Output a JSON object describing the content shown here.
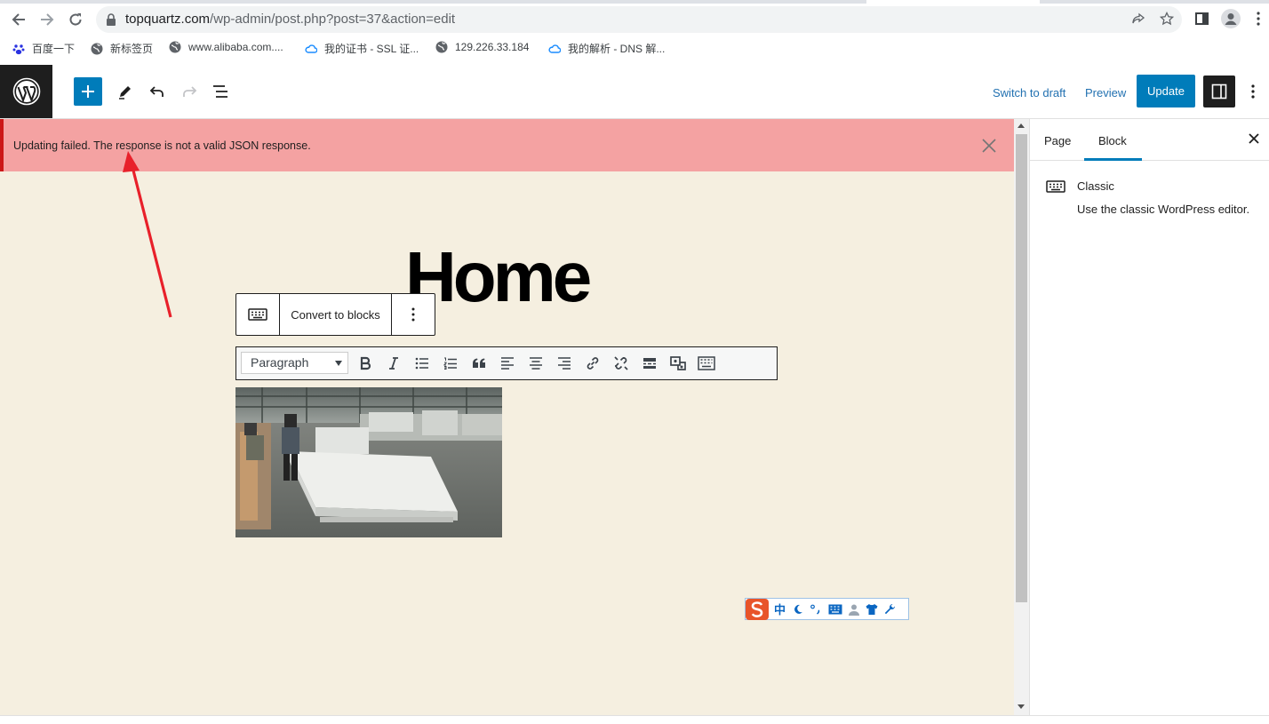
{
  "browser": {
    "url_host": "topquartz.com",
    "url_path": "/wp-admin/post.php?post=37&action=edit",
    "bookmarks": [
      {
        "label": "百度一下"
      },
      {
        "label": "新标签页"
      },
      {
        "label": "www.alibaba.com...."
      },
      {
        "label": "我的证书 - SSL 证..."
      },
      {
        "label": "129.226.33.184"
      },
      {
        "label": "我的解析 - DNS 解..."
      }
    ]
  },
  "topbar": {
    "switch_to_draft": "Switch to draft",
    "preview": "Preview",
    "update": "Update"
  },
  "notice": {
    "text": "Updating failed. The response is not a valid JSON response."
  },
  "editor": {
    "title": "Home",
    "block_toolbar": {
      "convert_label": "Convert to blocks"
    },
    "classic_toolbar": {
      "format_selected": "Paragraph"
    }
  },
  "ime": {
    "mode_char": "中"
  },
  "sidebar": {
    "tabs": [
      {
        "label": "Page"
      },
      {
        "label": "Block"
      }
    ],
    "active_tab": "Block",
    "block_name": "Classic",
    "block_description": "Use the classic WordPress editor."
  },
  "colors": {
    "accent": "#007cba",
    "notice_bg": "#f4a2a2",
    "notice_border": "#cc1818",
    "canvas_bg": "#f5efe0",
    "annotation_arrow": "#e8202a"
  }
}
